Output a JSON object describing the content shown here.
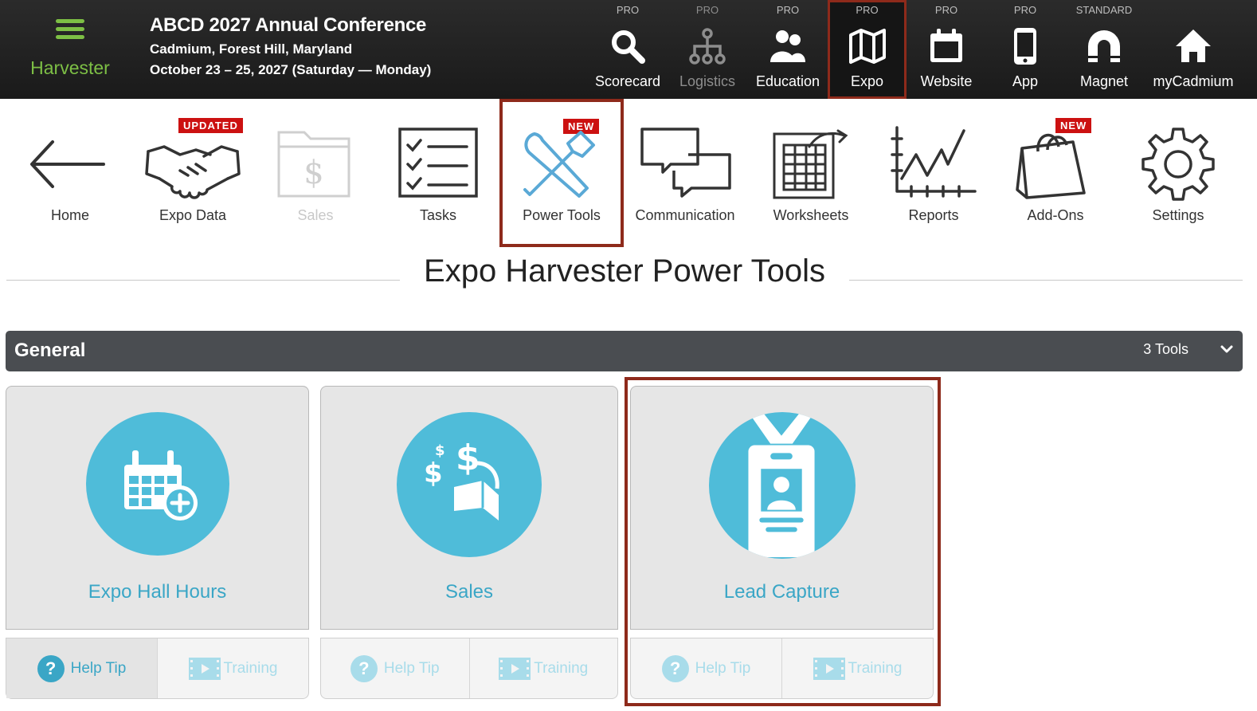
{
  "app": {
    "brand": "Harvester",
    "conference_title": "ABCD 2027 Annual Conference",
    "conference_location": "Cadmium, Forest Hill, Maryland",
    "conference_dates": "October 23 – 25, 2027 (Saturday — Monday)"
  },
  "top_nav": [
    {
      "tier": "PRO",
      "label": "Scorecard",
      "icon": "search-icon"
    },
    {
      "tier": "PRO",
      "label": "Logistics",
      "icon": "org-chart-icon"
    },
    {
      "tier": "PRO",
      "label": "Education",
      "icon": "people-icon"
    },
    {
      "tier": "PRO",
      "label": "Expo",
      "icon": "map-icon",
      "active": true
    },
    {
      "tier": "PRO",
      "label": "Website",
      "icon": "calendar-icon"
    },
    {
      "tier": "PRO",
      "label": "App",
      "icon": "phone-icon"
    },
    {
      "tier": "STANDARD",
      "label": "Magnet",
      "icon": "magnet-icon"
    },
    {
      "tier": "",
      "label": "myCadmium",
      "icon": "home-icon"
    }
  ],
  "sub_nav": [
    {
      "label": "Home",
      "icon": "back-arrow-icon"
    },
    {
      "label": "Expo Data",
      "icon": "handshake-icon",
      "badge": "UPDATED"
    },
    {
      "label": "Sales",
      "icon": "dollar-folder-icon",
      "disabled": true
    },
    {
      "label": "Tasks",
      "icon": "checklist-icon"
    },
    {
      "label": "Power Tools",
      "icon": "wrench-hammer-icon",
      "badge": "NEW",
      "active": true
    },
    {
      "label": "Communication",
      "icon": "chat-bubbles-icon"
    },
    {
      "label": "Worksheets",
      "icon": "spreadsheet-icon"
    },
    {
      "label": "Reports",
      "icon": "line-chart-icon"
    },
    {
      "label": "Add-Ons",
      "icon": "shopping-bag-icon",
      "badge": "NEW"
    },
    {
      "label": "Settings",
      "icon": "gear-icon"
    }
  ],
  "page": {
    "title": "Expo Harvester Power Tools"
  },
  "section": {
    "title": "General",
    "count": "3 Tools"
  },
  "tools": [
    {
      "label": "Expo Hall Hours",
      "icon": "calendar-add-icon",
      "help_label": "Help Tip",
      "training_label": "Training"
    },
    {
      "label": "Sales",
      "icon": "money-wallet-icon",
      "help_label": "Help Tip",
      "training_label": "Training"
    },
    {
      "label": "Lead Capture",
      "icon": "id-badge-icon",
      "help_label": "Help Tip",
      "training_label": "Training"
    }
  ],
  "colors": {
    "brand_green": "#7dbf45",
    "accent_blue": "#4fbcd9",
    "highlight_red": "#8e2a1b",
    "badge_red": "#cc1111",
    "section_bar": "#4a4d51"
  }
}
